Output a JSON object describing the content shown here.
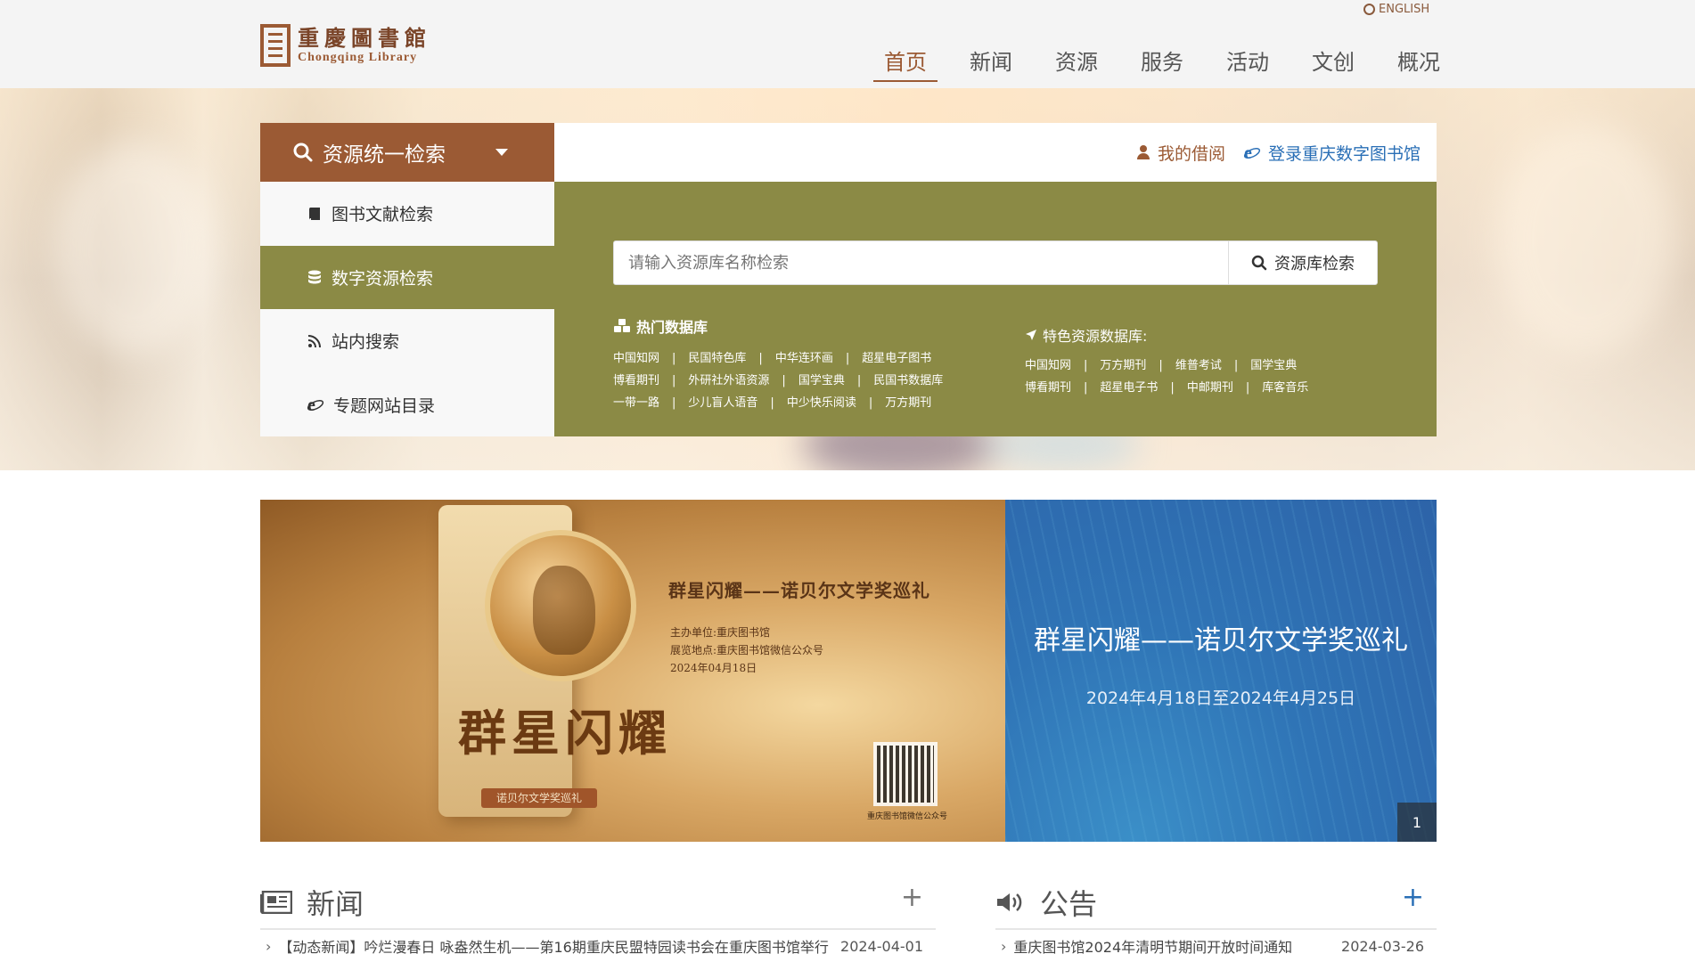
{
  "header": {
    "logo_cn": "重慶圖書館",
    "logo_en": "Chongqing Library",
    "language_link": "ENGLISH",
    "nav": [
      {
        "label": "首页",
        "active": true
      },
      {
        "label": "新闻"
      },
      {
        "label": "资源"
      },
      {
        "label": "服务"
      },
      {
        "label": "活动"
      },
      {
        "label": "文创"
      },
      {
        "label": "概况"
      }
    ]
  },
  "search": {
    "title": "资源统一检索",
    "tabs": [
      {
        "label": "图书文献检索",
        "icon": "book-icon"
      },
      {
        "label": "数字资源检索",
        "icon": "database-icon",
        "active": true
      },
      {
        "label": "站内搜索",
        "icon": "rss-icon"
      },
      {
        "label": "专题网站目录",
        "icon": "ie-icon"
      }
    ],
    "my_borrow": "我的借阅",
    "login_digital": "登录重庆数字图书馆",
    "placeholder": "请输入资源库名称检索",
    "button": "资源库检索",
    "hot_title": "热门数据库",
    "hot_rows": [
      [
        "中国知网",
        "民国特色库",
        "中华连环画",
        "超星电子图书"
      ],
      [
        "博看期刊",
        "外研社外语资源",
        "国学宝典",
        "民国书数据库"
      ],
      [
        "一带一路",
        "少儿盲人语音",
        "中少快乐阅读",
        "万方期刊"
      ]
    ],
    "special_title": "特色资源数据库:",
    "special_rows": [
      [
        "中国知网",
        "万方期刊",
        "维普考试",
        "国学宝典"
      ],
      [
        "博看期刊",
        "超星电子书",
        "中邮期刊",
        "库客音乐"
      ]
    ]
  },
  "banner": {
    "image_title": "群星闪耀——诺贝尔文学奖巡礼",
    "organizer": "主办单位:重庆图书馆",
    "venue": "展览地点:重庆图书馆微信公众号",
    "image_date": "2024年04月18日",
    "calligraphy": "群星闪耀",
    "tag": "诺贝尔文学奖巡礼",
    "qr_caption": "重庆图书馆微信公众号",
    "title": "群星闪耀——诺贝尔文学奖巡礼",
    "date_range": "2024年4月18日至2024年4月25日",
    "page": "1"
  },
  "news": {
    "title": "新闻",
    "items": [
      {
        "text": "【动态新闻】吟烂漫春日 咏盎然生机——第16期重庆民盟特园读书会在重庆图书馆举行",
        "date": "2024-04-01"
      }
    ]
  },
  "notice": {
    "title": "公告",
    "items": [
      {
        "text": "重庆图书馆2024年清明节期间开放时间通知",
        "date": "2024-03-26"
      }
    ]
  },
  "colors": {
    "brand_brown": "#9b5a34",
    "olive": "#8b8a45",
    "link_blue": "#2a6fb6"
  }
}
